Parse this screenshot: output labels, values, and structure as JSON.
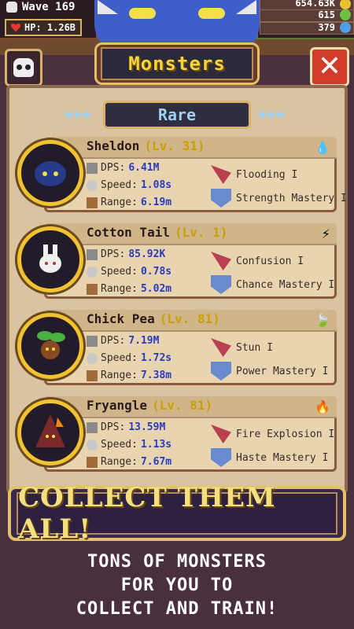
{
  "hud": {
    "wave_label": "Wave 169",
    "hp_label": "HP: 1.26B",
    "resources": [
      {
        "value": "654.63K",
        "icon": "gold-coin-icon"
      },
      {
        "value": "615",
        "icon": "green-gem-icon"
      },
      {
        "value": "379",
        "icon": "blue-gem-icon"
      }
    ]
  },
  "title": "Monsters",
  "tab": "Rare",
  "monsters": [
    {
      "name": "Sheldon",
      "level": "(Lv. 31)",
      "element": "water-drop-icon",
      "element_glyph": "💧",
      "dps": "6.41M",
      "speed": "1.08s",
      "range": "6.19m",
      "skill1": "Flooding I",
      "skill2": "Strength Mastery I"
    },
    {
      "name": "Cotton Tail",
      "level": "(Lv. 1)",
      "element": "lightning-icon",
      "element_glyph": "⚡",
      "dps": "85.92K",
      "speed": "0.78s",
      "range": "5.02m",
      "skill1": "Confusion I",
      "skill2": "Chance Mastery I"
    },
    {
      "name": "Chick Pea",
      "level": "(Lv. 81)",
      "element": "leaf-icon",
      "element_glyph": "🍃",
      "dps": "7.19M",
      "speed": "1.72s",
      "range": "7.38m",
      "skill1": "Stun I",
      "skill2": "Power Mastery I"
    },
    {
      "name": "Fryangle",
      "level": "(Lv. 81)",
      "element": "fire-icon",
      "element_glyph": "🔥",
      "dps": "13.59M",
      "speed": "1.13s",
      "range": "7.67m",
      "skill1": "Fire Explosion I",
      "skill2": "Haste Mastery I"
    }
  ],
  "stat_labels": {
    "dps": "DPS:",
    "speed": "Speed:",
    "range": "Range:"
  },
  "banner": "COLLECT THEM ALL!",
  "footer": [
    "TONS OF MONSTERS",
    "FOR YOU TO",
    "COLLECT AND TRAIN!"
  ],
  "colors": {
    "accent_gold": "#f2c230",
    "value_blue": "#2a3ac0",
    "panel": "#d9c3a0"
  }
}
